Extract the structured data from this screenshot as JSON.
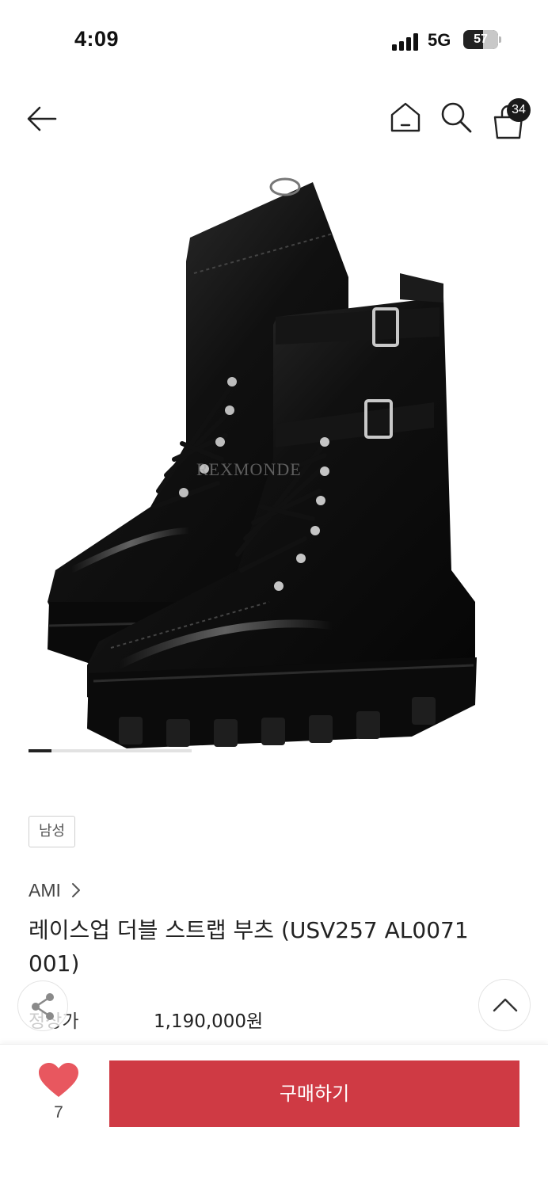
{
  "status_bar": {
    "time": "4:09",
    "network": "5G",
    "battery": "57",
    "battery_fraction": 0.57
  },
  "header": {
    "back_icon": "arrow-left-icon",
    "home_icon": "home-icon",
    "search_icon": "search-icon",
    "bag_icon": "shopping-bag-icon",
    "bag_count": "34"
  },
  "product": {
    "image_watermark": "REXMONDE",
    "gallery_progress": 0.14,
    "gender_tag": "남성",
    "brand": "AMI",
    "title": "레이스업 더블 스트랩 부츠 (USV257 AL0071 001)",
    "price_label": "정상가",
    "price": "1,190,000원"
  },
  "floating": {
    "share_icon": "share-icon",
    "scroll_top_icon": "chevron-up-icon"
  },
  "bottom_bar": {
    "like_icon": "heart-icon",
    "like_count": "7",
    "buy_label": "구매하기"
  },
  "colors": {
    "accent": "#cf3a44",
    "heart": "#e8575f",
    "text": "#222222"
  }
}
